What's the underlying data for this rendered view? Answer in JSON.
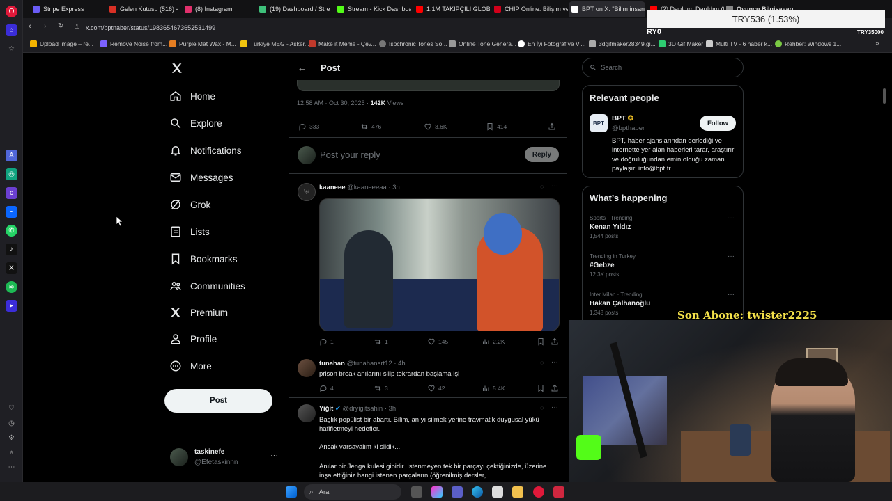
{
  "tabs": [
    {
      "label": "Stripe Express",
      "color": "#6a5cf6"
    },
    {
      "label": "Gelen Kutusu (516) - nor",
      "color": "#d93025"
    },
    {
      "label": "(8) Instagram",
      "color": "#e1306c"
    },
    {
      "label": "(19) Dashboard / Stream",
      "color": "#3ec07a"
    },
    {
      "label": "Stream - Kick Dashboard",
      "color": "#53fc18"
    },
    {
      "label": "1.1M TAKİPÇİLİ GLOBAL",
      "color": "#ff0000"
    },
    {
      "label": "CHIP Online: Bilişim ve T",
      "color": "#d2001a"
    },
    {
      "label": "BPT on X: \"Bilim insanları",
      "color": "#ffffff"
    },
    {
      "label": "(2) Darıldım Darıldım (fe",
      "color": "#ff0000"
    },
    {
      "label": "Oyuncu Bilgisayarı",
      "color": "#888888"
    }
  ],
  "address": {
    "url": "x.com/bptnaber/status/1983654673652531499"
  },
  "bookmarks": [
    {
      "label": "Upload Image – re...",
      "color": "#f4b400"
    },
    {
      "label": "Remove Noise from...",
      "color": "#7b61ff"
    },
    {
      "label": "Purple Mat Wax - M...",
      "color": "#e67e22"
    },
    {
      "label": "Türkiye MEG - Asker...",
      "color": "#f1c40f"
    },
    {
      "label": "Make it Meme - Çev...",
      "color": "#c0392b"
    },
    {
      "label": "Isochronic Tones So...",
      "color": "#777777"
    },
    {
      "label": "Online Tone Genera...",
      "color": "#999999"
    },
    {
      "label": "En İyi Fotoğraf ve Vi...",
      "color": "#ffffff"
    },
    {
      "label": "3dgifmaker28349.gi...",
      "color": "#aaaaaa"
    },
    {
      "label": "3D Gif Maker",
      "color": "#2ecc71"
    },
    {
      "label": "Multi TV - 6 haber k...",
      "color": "#cccccc"
    },
    {
      "label": "Rehber: Windows 1...",
      "color": "#7ac943"
    }
  ],
  "nav": {
    "items": [
      {
        "label": "Home",
        "icon": "home-icon"
      },
      {
        "label": "Explore",
        "icon": "search-icon"
      },
      {
        "label": "Notifications",
        "icon": "bell-icon"
      },
      {
        "label": "Messages",
        "icon": "mail-icon"
      },
      {
        "label": "Grok",
        "icon": "grok-icon"
      },
      {
        "label": "Lists",
        "icon": "list-icon"
      },
      {
        "label": "Bookmarks",
        "icon": "bookmark-icon"
      },
      {
        "label": "Communities",
        "icon": "people-icon"
      },
      {
        "label": "Premium",
        "icon": "x-logo-icon"
      },
      {
        "label": "Profile",
        "icon": "person-icon"
      },
      {
        "label": "More",
        "icon": "more-circle-icon"
      }
    ],
    "post_button": "Post",
    "account": {
      "name": "taskinefe",
      "handle": "@Efetaskinnn"
    }
  },
  "post": {
    "header": "Post",
    "timestamp": "12:58 AM · Oct 30, 2025 · ",
    "views_count": "142K",
    "views_label": " Views",
    "replies": "333",
    "reposts": "476",
    "likes": "3.6K",
    "bookmarks": "414",
    "reply_placeholder": "Post your reply",
    "reply_button": "Reply"
  },
  "replies": [
    {
      "name": "kaaneee",
      "handle": "@kaaneeeaa · 3h",
      "text": "",
      "replies": "1",
      "reposts": "1",
      "likes": "145",
      "views": "2.2K"
    },
    {
      "name": "tunahan",
      "handle": "@tunahansrt12 · 4h",
      "text": "prison break anılarını silip tekrardan başlama işi",
      "replies": "4",
      "reposts": "3",
      "likes": "42",
      "views": "5.4K"
    },
    {
      "name": "Yiğit",
      "handle": "@dryigitsahin · 3h",
      "text1": "Başlık popülist bir abartı. Bilim, anıyı silmek yerine travmatik duygusal yükü hafifletmeyi hedefler.",
      "text2": "Ancak varsayalım ki sildik...",
      "text3": "Anılar bir Jenga kulesi gibidir. İstenmeyen tek bir parçayı çektiğinizde, üzerine inşa ettiğiniz hangi istenen parçaların (öğrenilmiş dersler,"
    }
  ],
  "right": {
    "search_placeholder": "Search",
    "relevant_title": "Relevant people",
    "person": {
      "name": "BPT",
      "handle": "@bpthaber",
      "bio": "BPT, haber ajanslarından derlediği ve internette yer alan haberleri tarar, araştırır ve doğruluğundan emin olduğu zaman paylaşır. info@bpt.tr",
      "follow": "Follow"
    },
    "happening_title": "What’s happening",
    "trends": [
      {
        "meta": "Sports · Trending",
        "name": "Kenan Yıldız",
        "posts": "1,544 posts"
      },
      {
        "meta": "Trending in Turkey",
        "name": "#Gebze",
        "posts": "12.3K posts"
      },
      {
        "meta": "Inter Milan · Trending",
        "name": "Hakan Çalhanoğlu",
        "posts": "1,348 posts"
      }
    ]
  },
  "stream_overlay": {
    "price": "TRY536 (1.53%)",
    "ticker_left": "RY0",
    "ticker_right": "TRY35000",
    "subscriber": "Son Abone: twister2225"
  },
  "taskbar": {
    "search_placeholder": "Ara"
  }
}
